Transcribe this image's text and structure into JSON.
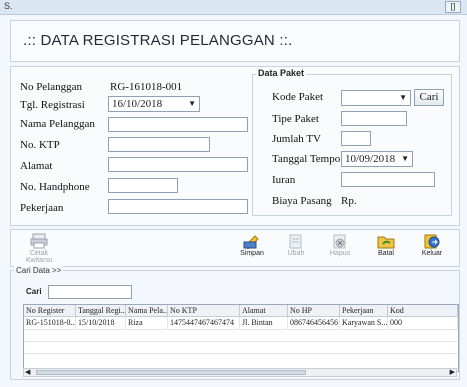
{
  "window": {
    "app_label": "S.",
    "corner_label": "[]"
  },
  "header": {
    "title": ".:: DATA REGISTRASI PELANGGAN ::."
  },
  "form": {
    "no_pelanggan_label": "No Pelanggan",
    "no_pelanggan_value": "RG-161018-001",
    "tgl_registrasi_label": "Tgl. Registrasi",
    "tgl_registrasi_value": "16/10/2018",
    "nama_label": "Nama Pelanggan",
    "ktp_label": "No. KTP",
    "alamat_label": "Alamat",
    "hp_label": "No. Handphone",
    "pekerjaan_label": "Pekerjaan"
  },
  "paket": {
    "legend": "Data Paket",
    "kode_label": "Kode Paket",
    "cari_button": "Cari",
    "tipe_label": "Tipe Paket",
    "jumlah_label": "Jumlah TV",
    "tempo_label": "Tanggal Tempo",
    "tempo_value": "10/09/2018",
    "iuran_label": "Iuran",
    "biaya_label": "Biaya Pasang",
    "biaya_value": "Rp."
  },
  "toolbar": {
    "cetak": "Cetak Kwitansi",
    "simpan": "Simpan",
    "ubah": "Ubah",
    "hapus": "Hapus",
    "batal": "Batal",
    "keluar": "Keluar"
  },
  "search": {
    "group_label": "Cari Data >>",
    "cari_label": "Cari"
  },
  "table": {
    "headers": [
      "No Register",
      "Tanggal Regi...",
      "Nama Pela...",
      "No KTP",
      "Alamat",
      "No HP",
      "Pekerjaan",
      "Kod"
    ],
    "rows": [
      [
        "RG-151018-0...",
        "15/10/2018",
        "Riza",
        "1475447467467474",
        "Jl. Bintan",
        "086746456456",
        "Karyawan S...",
        "000"
      ]
    ]
  }
}
